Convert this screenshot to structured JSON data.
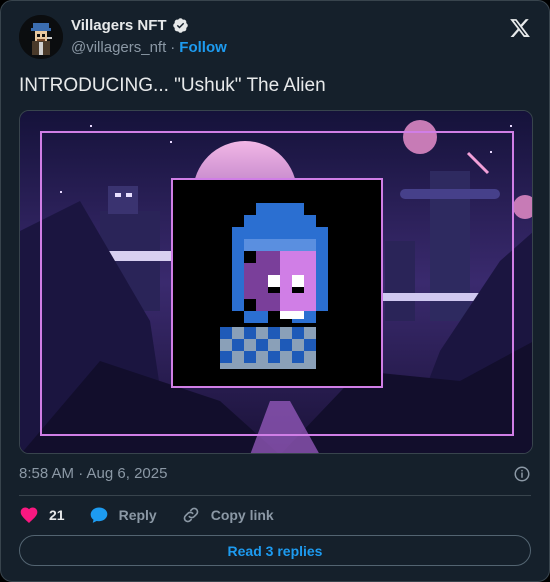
{
  "account": {
    "name": "Villagers NFT",
    "handle": "@villagers_nft",
    "separator": "·",
    "follow_label": "Follow",
    "verified_icon": "verified-badge-icon",
    "logo_icon": "x-logo-icon"
  },
  "tweet": {
    "text": "INTRODUCING... \"Ushuk\" The Alien",
    "media_description_icon": "alien-pixel-art-image",
    "timestamp": "8:58 AM · Aug 6, 2025"
  },
  "actions": {
    "like_count": "21",
    "reply_label": "Reply",
    "copy_link_label": "Copy link",
    "read_replies_label": "Read 3 replies"
  },
  "colors": {
    "background": "#15202b",
    "accent": "#1d9bf0",
    "like": "#f91880",
    "muted": "#8b98a5",
    "text": "#e7e9ea",
    "frame": "#d07ee6"
  }
}
